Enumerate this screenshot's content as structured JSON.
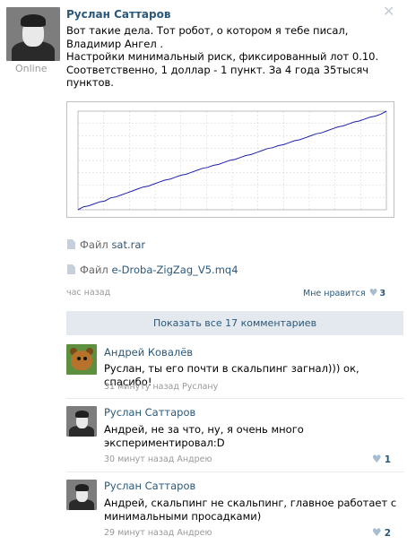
{
  "post": {
    "author": "Руслан Саттаров",
    "status": "Online",
    "close_icon": "close-icon",
    "text_lines": [
      "Вот такие дела. Тот робот, о котором я тебе писал,",
      "Владимир Ангел .",
      "Настройки минимальный риск, фиксированный лот 0.10.",
      "Соответственно, 1 доллар - 1 пункт. За 4 года 35тысяч",
      "пунктов."
    ],
    "files": [
      {
        "label": "Файл",
        "name": "sat.rar"
      },
      {
        "label": "Файл",
        "name": "e-Droba-ZigZag_V5.mq4"
      }
    ],
    "time": "час назад",
    "like_label": "Мне нравится",
    "like_count": "3",
    "show_all": "Показать все 17 комментариев"
  },
  "comments": [
    {
      "author": "Андрей Ковалёв",
      "text_lines": [
        "Руслан, ты его почти в скальпинг загнал))) ок, спасибо!"
      ],
      "time": "31 минуту назад",
      "reply_to": "Руслану",
      "likes": ""
    },
    {
      "author": "Руслан Саттаров",
      "text_lines": [
        "Андрей, не за что, ну, я очень много",
        "экспериментировал:D"
      ],
      "time": "30 минут назад",
      "reply_to": "Андрею",
      "likes": "1"
    },
    {
      "author": "Руслан Саттаров",
      "text_lines": [
        "Андрей, скальпинг не скальпинг, главное работает с",
        "минимальными просадками)"
      ],
      "time": "29 минут назад",
      "reply_to": "Андрею",
      "likes": "2"
    }
  ],
  "colors": {
    "link": "#2b587a",
    "chart_line": "#2020b0",
    "grid": "#d0d0d0",
    "muted": "#999999"
  },
  "chart_data": {
    "type": "line",
    "title": "",
    "xlabel": "",
    "ylabel": "",
    "grid": true,
    "series": [
      {
        "values": [
          0,
          3,
          4,
          6,
          8,
          9,
          12,
          13,
          15,
          17,
          19,
          21,
          23,
          24,
          26,
          28,
          30,
          31,
          33,
          35,
          36,
          38,
          40,
          42,
          43,
          45,
          46,
          48,
          50,
          51,
          53,
          55,
          56,
          58,
          60,
          62,
          63,
          65,
          66,
          68,
          70,
          71,
          73,
          75,
          77,
          78,
          80,
          82,
          84,
          85,
          87,
          89,
          90,
          92,
          94,
          95,
          97,
          100
        ]
      }
    ],
    "ylim": [
      0,
      100
    ]
  }
}
